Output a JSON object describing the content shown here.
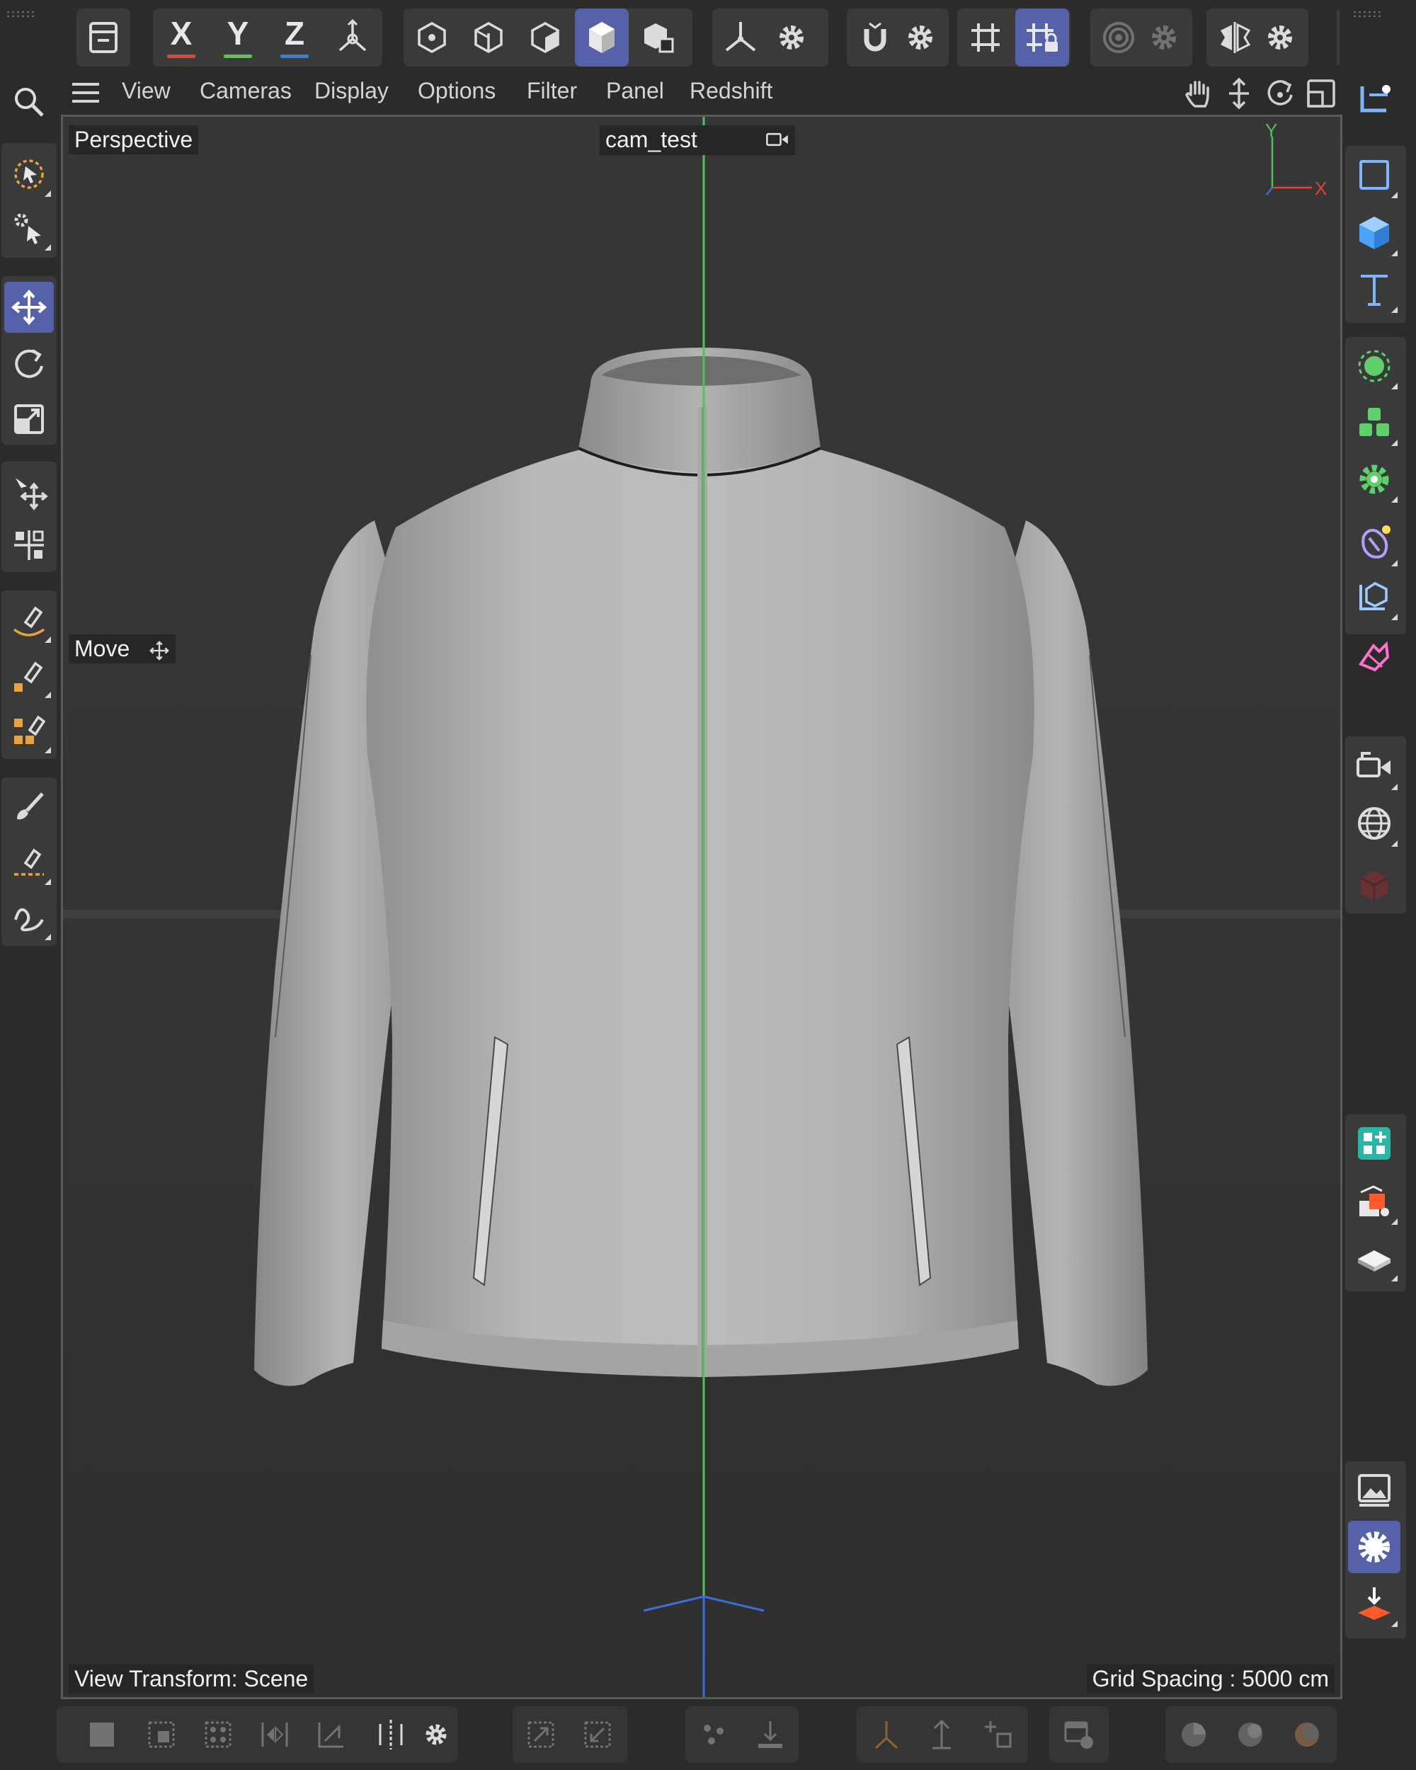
{
  "top_toolbar": {
    "coord_system_icon": "coordinate-system-icon",
    "axis_x": "X",
    "axis_y": "Y",
    "axis_z": "Z",
    "axis_colors": {
      "x": "#e0423c",
      "y": "#57c84d",
      "z": "#3a7be0"
    },
    "world_axis_icon": "world-axis-icon",
    "points_mode_icon": "points-mode-icon",
    "edges_mode_icon": "edges-mode-icon",
    "polygons_mode_icon": "polygons-mode-icon",
    "model_mode_icon": "model-mode-icon",
    "uv_mode_icon": "uv-mode-icon",
    "axis_mode_icon": "axis-mode-icon",
    "snap_icon": "snap-magnet-icon",
    "grid_icon": "grid-icon",
    "grid_lock_icon": "grid-lock-icon",
    "soft_selection_icon": "soft-selection-icon",
    "symmetry_icon": "symmetry-icon",
    "settings_icon": "gear-icon",
    "active_accent": "#5561a8"
  },
  "menubar": {
    "items": [
      "View",
      "Cameras",
      "Display",
      "Options",
      "Filter",
      "Panel",
      "Redshift"
    ]
  },
  "viewport": {
    "view_name": "Perspective",
    "camera_name": "cam_test",
    "active_tool": "Move",
    "view_transform": "View Transform: Scene",
    "grid_spacing": "Grid Spacing : 5000 cm",
    "axis_labels": {
      "y": "Y",
      "x": "X"
    }
  },
  "left_toolbar": {
    "tools": [
      "live-selection",
      "select-tool",
      "move",
      "rotate",
      "scale",
      "transform",
      "placement",
      "spline-pen",
      "spline-points",
      "spline-edit",
      "paint-brush",
      "spline-draw",
      "sketch"
    ],
    "active": "move"
  },
  "right_toolbar": {
    "tools": [
      "null-object",
      "spline",
      "cube",
      "text",
      "subdivision-surface",
      "cloner",
      "volume-builder",
      "deformer",
      "field",
      "camera",
      "environment",
      "redshift-object",
      "material-manager",
      "takes",
      "floor",
      "render-view",
      "render-settings",
      "render-to-picture-viewer"
    ],
    "active": "render-settings"
  }
}
